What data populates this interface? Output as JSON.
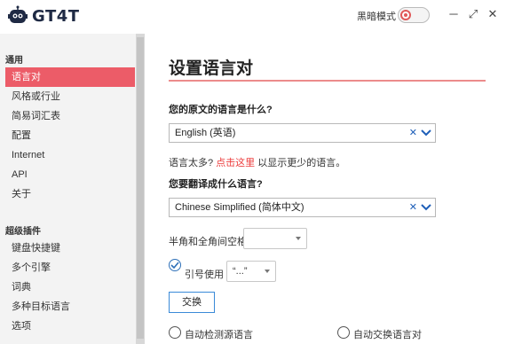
{
  "app": {
    "logo_text": "GT4T",
    "dark_mode_label": "黑暗模式",
    "window_buttons": {
      "minimize": "─",
      "maximize": "⤢",
      "close": "✕"
    }
  },
  "sidebar": {
    "section_general": "通用",
    "general_items": [
      {
        "label": "语言对",
        "active": true
      },
      {
        "label": "风格或行业",
        "active": false
      },
      {
        "label": "简易词汇表",
        "active": false
      },
      {
        "label": "配置",
        "active": false
      },
      {
        "label": "Internet",
        "active": false
      },
      {
        "label": "API",
        "active": false
      },
      {
        "label": "关于",
        "active": false
      }
    ],
    "section_plugins": "超级插件",
    "plugin_items": [
      {
        "label": "键盘快捷键"
      },
      {
        "label": "多个引擎"
      },
      {
        "label": "词典"
      },
      {
        "label": "多种目标语言"
      },
      {
        "label": "选项"
      }
    ]
  },
  "main": {
    "title": "设置语言对",
    "source_question": "您的原文的语言是什么?",
    "source_value": "English (英语)",
    "hint_prefix": "语言太多?",
    "hint_link": "点击这里",
    "hint_suffix": "以显示更少的语言。",
    "target_question": "您要翻译成什么语言?",
    "target_value": "Chinese Simplified (简体中文)",
    "spacing_label": "半角和全角间空格",
    "spacing_value": "",
    "quotes_label": "引号使用",
    "quotes_value": "“...”",
    "quotes_checked": true,
    "swap_button": "交换",
    "auto_detect_label": "自动检测源语言",
    "auto_swap_label": "自动交换语言对",
    "clear_glyph": "✕"
  },
  "colors": {
    "accent": "#ec5c68",
    "link": "#ec3b3b",
    "select_icon": "#1e5fb8",
    "button_border": "#3a8ad8"
  }
}
